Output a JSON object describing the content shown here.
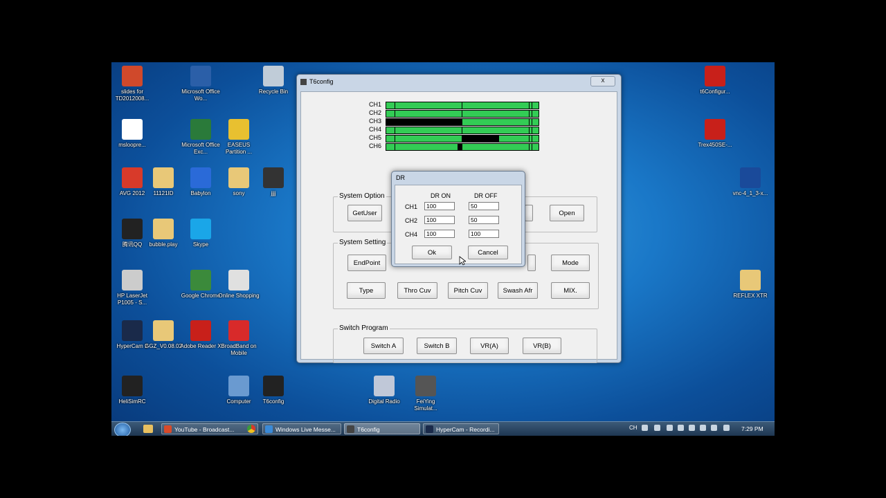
{
  "desktop": {
    "icons": [
      {
        "label": "slides for TD2012008...",
        "icon": "powerpoint-file-icon",
        "color": "#d0492b"
      },
      {
        "label": "Microsoft Office Wo...",
        "icon": "word-icon",
        "color": "#2b5fa8"
      },
      {
        "label": "Recycle Bin",
        "icon": "recycle-bin-icon",
        "color": "#c0ccd8"
      },
      {
        "label": "msloopre...",
        "icon": "document-icon",
        "color": "#ffffff"
      },
      {
        "label": "Microsoft Office Exc...",
        "icon": "excel-icon",
        "color": "#2a7a3a"
      },
      {
        "label": "EASEUS Partition ...",
        "icon": "easeus-icon",
        "color": "#e8c030"
      },
      {
        "label": "AVG 2012",
        "icon": "avg-icon",
        "color": "#d83a2a"
      },
      {
        "label": "11121ID",
        "icon": "folder-icon",
        "color": "#e8c878"
      },
      {
        "label": "Babylon",
        "icon": "babylon-icon",
        "color": "#2a6ad8"
      },
      {
        "label": "sony",
        "icon": "folder-icon",
        "color": "#e8c878"
      },
      {
        "label": "jjjj",
        "icon": "app-icon",
        "color": "#333333"
      },
      {
        "label": "腾讯QQ",
        "icon": "qq-icon",
        "color": "#222222"
      },
      {
        "label": "bubble.play",
        "icon": "folder-icon",
        "color": "#e8c878"
      },
      {
        "label": "Skype",
        "icon": "skype-icon",
        "color": "#1aa6e8"
      },
      {
        "label": "HP LaserJet P1005 - S...",
        "icon": "printer-icon",
        "color": "#cccccc"
      },
      {
        "label": "Google Chrome",
        "icon": "chrome-icon",
        "color": "#3b8a3b"
      },
      {
        "label": "Online Shopping",
        "icon": "shopping-icon",
        "color": "#e0e0e0"
      },
      {
        "label": "HyperCam 2",
        "icon": "hypercam-icon",
        "color": "#1a2a4a"
      },
      {
        "label": "GGZ_V0.08.02",
        "icon": "folder-icon",
        "color": "#e8c878"
      },
      {
        "label": "Adobe Reader X",
        "icon": "pdf-icon",
        "color": "#c8201a"
      },
      {
        "label": "BroadBand on Mobile",
        "icon": "broadband-icon",
        "color": "#d82a2a"
      },
      {
        "label": "HeliSimRC",
        "icon": "helicopter-icon",
        "color": "#222222"
      },
      {
        "label": "Computer",
        "icon": "computer-icon",
        "color": "#6a9ad0"
      },
      {
        "label": "T6config",
        "icon": "radio-transmitter-icon",
        "color": "#222222"
      },
      {
        "label": "Digital Radio",
        "icon": "digital-radio-icon",
        "color": "#c0c8d8"
      },
      {
        "label": "FeiYing Simulat...",
        "icon": "simulator-icon",
        "color": "#555555"
      },
      {
        "label": "t6Configur...",
        "icon": "pdf-icon",
        "color": "#c8201a"
      },
      {
        "label": "Trex450SE-...",
        "icon": "pdf-icon",
        "color": "#c8201a"
      },
      {
        "label": "vnc-4_1_3-x...",
        "icon": "vnc-icon",
        "color": "#1a4a9a"
      },
      {
        "label": "REFLEX XTR",
        "icon": "folder-icon",
        "color": "#e8c878"
      }
    ]
  },
  "window": {
    "title": "T6config",
    "close_label": "x",
    "channels": [
      {
        "label": "CH1",
        "fill_from": 0.5,
        "fill_to": 0.5
      },
      {
        "label": "CH2",
        "fill_from": 0.5,
        "fill_to": 0.5
      },
      {
        "label": "CH3",
        "fill_from": 0.0,
        "fill_to": 0.5
      },
      {
        "label": "CH4",
        "fill_from": 0.5,
        "fill_to": 0.5
      },
      {
        "label": "CH5",
        "fill_from": 0.5,
        "fill_to": 0.74
      },
      {
        "label": "CH6",
        "fill_from": 0.47,
        "fill_to": 0.5
      }
    ],
    "system_option": {
      "label": "System Option",
      "getuser": "GetUser",
      "open": "Open"
    },
    "system_setting": {
      "label": "System Setting",
      "endpoint": "EndPoint",
      "mode": "Mode",
      "type": "Type",
      "thro_cuv": "Thro Cuv",
      "pitch_cuv": "Pitch Cuv",
      "swash_afr": "Swash Afr",
      "mix": "MIX."
    },
    "switch_program": {
      "label": "Switch Program",
      "switch_a": "Switch A",
      "switch_b": "Switch B",
      "vr_a": "VR(A)",
      "vr_b": "VR(B)"
    }
  },
  "dr_dialog": {
    "title": "DR",
    "col_on": "DR ON",
    "col_off": "DR OFF",
    "rows": [
      {
        "label": "CH1",
        "on": "100",
        "off": "50"
      },
      {
        "label": "CH2",
        "on": "100",
        "off": "50"
      },
      {
        "label": "CH4",
        "on": "100",
        "off": "100"
      }
    ],
    "ok": "Ok",
    "cancel": "Cancel"
  },
  "taskbar": {
    "start_label": "Start",
    "items": [
      {
        "label": "YouTube - Broadcast...",
        "color": "#d84a2a"
      },
      {
        "label": "Windows Live Messe...",
        "color": "#3a8ad8"
      },
      {
        "label": "T6config",
        "color": "#444444"
      },
      {
        "label": "HyperCam - Recordi...",
        "color": "#1a2a4a"
      }
    ],
    "lang": "CH",
    "clock": "7:29 PM"
  }
}
